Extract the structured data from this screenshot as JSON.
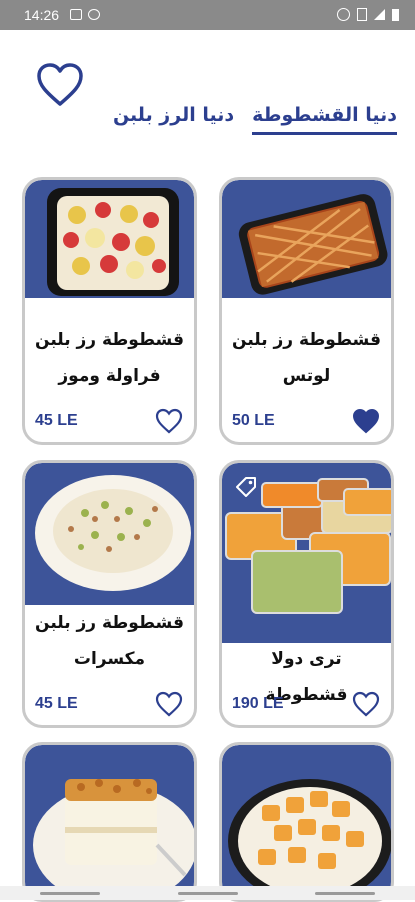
{
  "status_bar": {
    "time": "14:26"
  },
  "tabs": [
    {
      "label": "دنيا القشطوطة",
      "active": true
    },
    {
      "label": "دنيا الرز بلبن",
      "active": false
    }
  ],
  "products": [
    {
      "title": "قشطوطة رز بلبن لوتس",
      "price": "50 LE",
      "favorited": true,
      "image": "lotus-rice-pudding-image"
    },
    {
      "title": "قشطوطة رز بلبن فراولة وموز",
      "price": "45 LE",
      "favorited": false,
      "image": "strawberry-banana-rice-pudding-image"
    },
    {
      "title": "ترى دولا قشطوطة",
      "price": "190 LE",
      "favorited": false,
      "image": "tre-dola-tray-image"
    },
    {
      "title": "قشطوطة رز بلبن مكسرات",
      "price": "45 LE",
      "favorited": false,
      "image": "nuts-rice-pudding-image"
    },
    {
      "title": "",
      "price": "",
      "favorited": false,
      "image": "mango-dessert-image"
    },
    {
      "title": "",
      "price": "",
      "favorited": false,
      "image": "caramel-cake-image"
    }
  ],
  "colors": {
    "accent": "#2c3f8f",
    "card_image_bg": "#3d5499"
  }
}
